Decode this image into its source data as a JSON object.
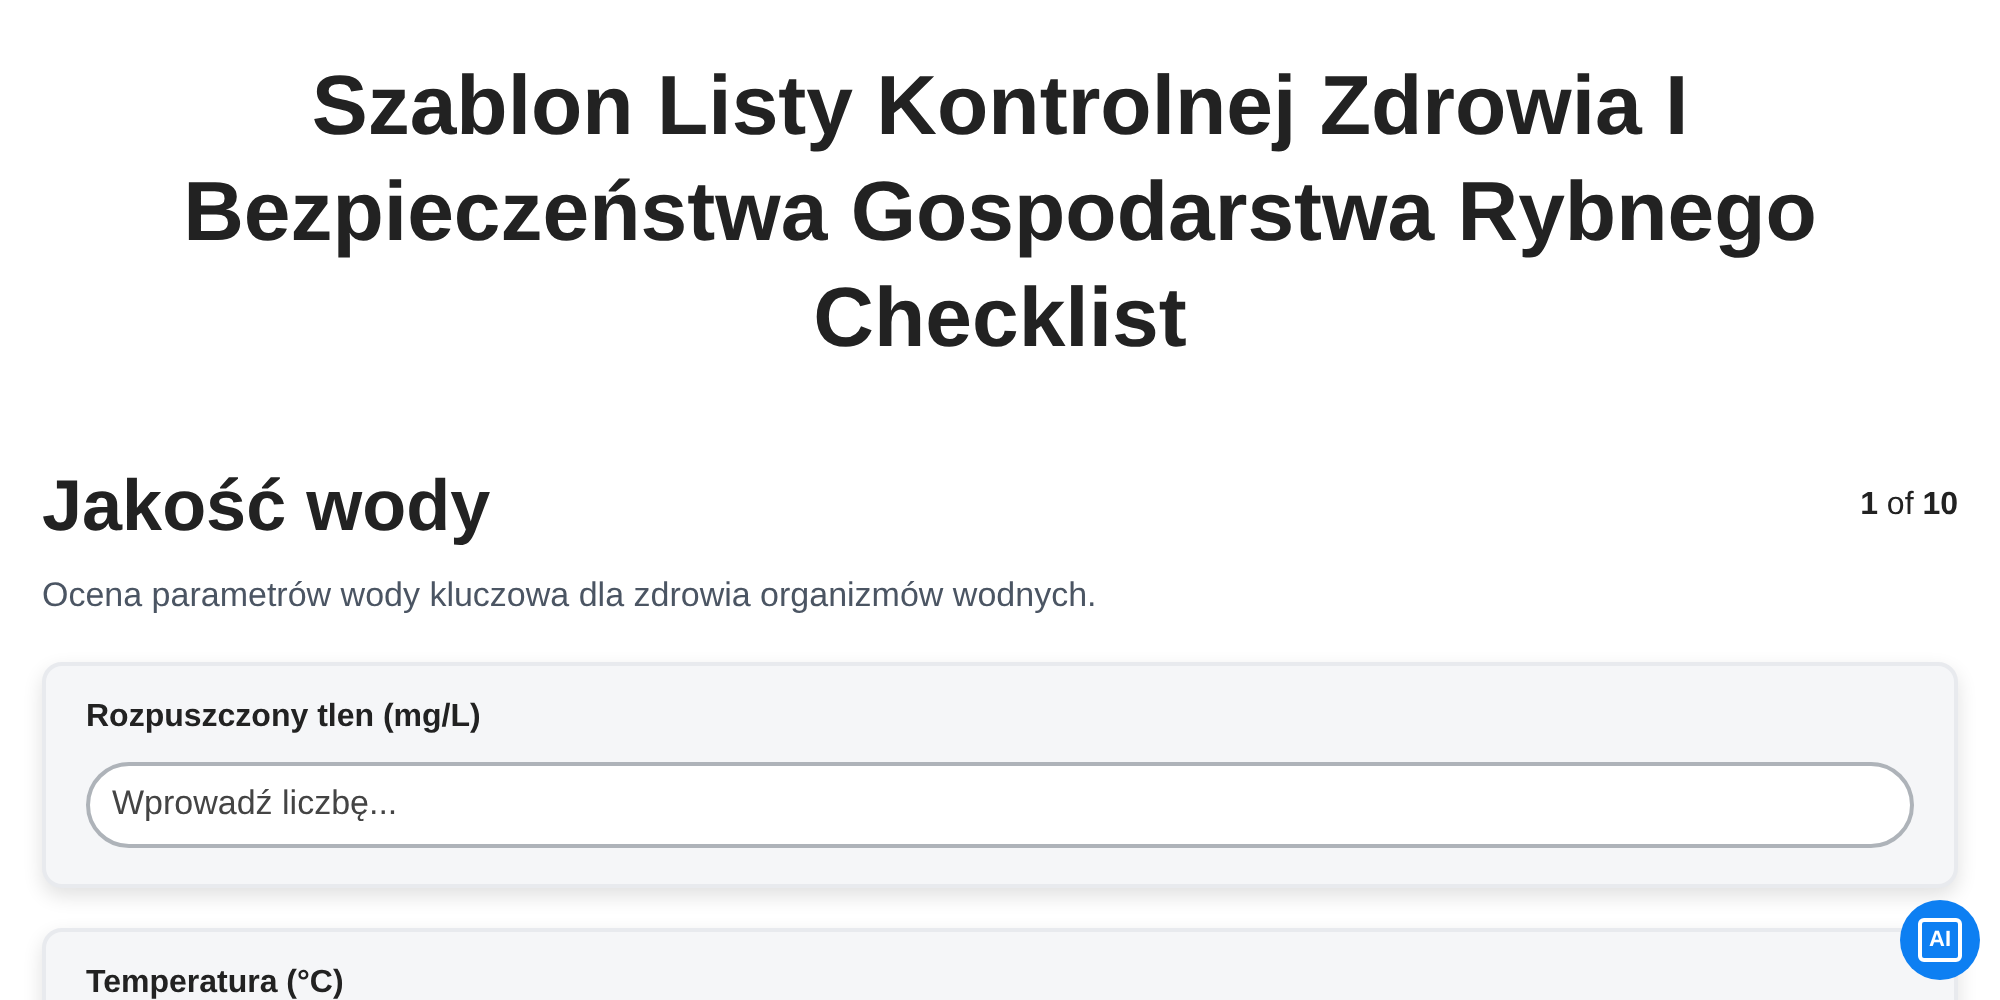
{
  "title": "Szablon Listy Kontrolnej Zdrowia I Bezpieczeństwa Gospodarstwa Rybnego Checklist",
  "section": {
    "heading": "Jakość wody",
    "progress": "**1** of **10**",
    "description": "Ocena parametrów wody kluczowa dla zdrowia organizmów wodnych."
  },
  "questions": [
    {
      "label": "Rozpuszczony tlen (mg/L)",
      "placeholder": "Wprowadź liczbę..."
    },
    {
      "label": "Temperatura (°C)"
    }
  ],
  "ai_badge": "AI"
}
